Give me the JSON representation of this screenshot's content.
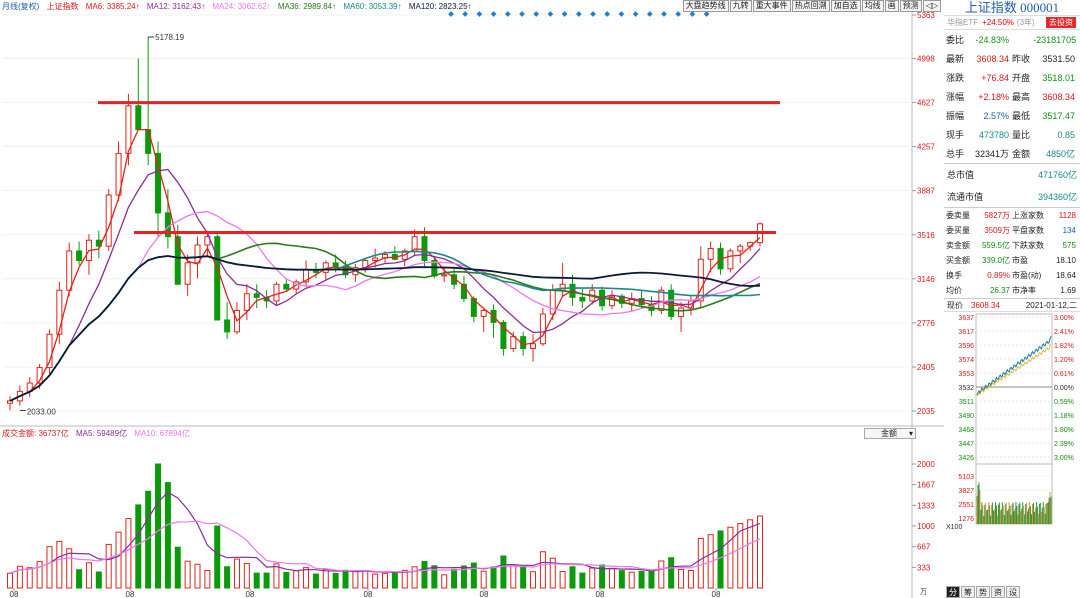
{
  "legend": {
    "period": "月线(复权)",
    "index": "上证指数",
    "ma6": "MA6: 3385.24↑",
    "ma12": "MA12: 3162.43↑",
    "ma24": "MA24: 3062.62↑",
    "ma36": "MA36: 2989.84↑",
    "ma60": "MA60: 3053.39↑",
    "ma120": "MA120: 2823.25↑"
  },
  "toolbar": [
    "大盘趋势线",
    "九转",
    "重大事件",
    "热点回溯",
    "加自选",
    "均线",
    "画",
    "预测",
    "◁▷"
  ],
  "price_axis": [
    "5363",
    "4998",
    "4627",
    "4257",
    "3887",
    "3516",
    "3146",
    "2776",
    "2405",
    "2035"
  ],
  "high_label": "5178.19",
  "low_label": "2033.00",
  "volume_legend": {
    "title": "成交金额: 36737亿",
    "ma5": "MA5: 59489亿",
    "ma10": "MA10: 67894亿"
  },
  "volume_select": "金额",
  "volume_axis": [
    "2000",
    "1667",
    "1333",
    "1000",
    "667",
    "333"
  ],
  "volume_unit": "万",
  "x_labels": [
    "08",
    "08",
    "08",
    "08",
    "08",
    "08",
    "08"
  ],
  "colors": {
    "up": "#e0241a",
    "down": "#0a9a0a",
    "resistance": "#e62222",
    "ma6": "#e0241a",
    "ma12": "#8a2c9a",
    "ma24": "#ee77ee",
    "ma36": "#2a7a18",
    "ma60": "#1a8a8a",
    "ma120": "#0a1a3a"
  },
  "panel": {
    "title": "上证指数 000001",
    "etf": {
      "name": "华指ETF",
      "change": "+24.50%",
      "tag": "(3年)",
      "button": "去投资"
    },
    "quote": [
      {
        "l": "委比",
        "v": "-24.83%",
        "vc": "g",
        "l2": "",
        "v2": "-23181705",
        "v2c": "g"
      },
      {
        "l": "最新",
        "v": "3608.34",
        "vc": "r",
        "l2": "昨收",
        "v2": "3531.50",
        "v2c": "k"
      },
      {
        "l": "涨跌",
        "v": "+76.84",
        "vc": "r",
        "l2": "开盘",
        "v2": "3518.01",
        "v2c": "g"
      },
      {
        "l": "涨幅",
        "v": "+2.18%",
        "vc": "r",
        "l2": "最高",
        "v2": "3608.34",
        "v2c": "r"
      },
      {
        "l": "振幅",
        "v": "2.57%",
        "vc": "bl",
        "l2": "最低",
        "v2": "3517.47",
        "v2c": "g"
      },
      {
        "l": "现手",
        "v": "473780",
        "vc": "tl",
        "l2": "量比",
        "v2": "0.85",
        "v2c": "tl"
      },
      {
        "l": "总手",
        "v": "32341万",
        "vc": "k",
        "l2": "金额",
        "v2": "4850亿",
        "v2c": "tl"
      }
    ],
    "total_cap": {
      "l": "总市值",
      "v": "471760亿"
    },
    "float_cap": {
      "l": "流通市值",
      "v": "394360亿"
    },
    "stats": [
      {
        "l": "委卖量",
        "v": "5827万",
        "vc": "r",
        "l2": "上涨家数",
        "v2": "1128",
        "v2c": "r"
      },
      {
        "l": "委买量",
        "v": "3509万",
        "vc": "r",
        "l2": "平盘家数",
        "v2": "134",
        "v2c": "bl"
      },
      {
        "l": "卖金额",
        "v": "559.5亿",
        "vc": "g",
        "l2": "下跌家数",
        "v2": "575",
        "v2c": "g"
      },
      {
        "l": "买金额",
        "v": "339.0亿",
        "vc": "g",
        "l2": "市盈",
        "v2": "18.10",
        "v2c": "k"
      },
      {
        "l": "换手",
        "v": "0.89%",
        "vc": "r",
        "l2": "市盈(动)",
        "v2": "18.64",
        "v2c": "k"
      },
      {
        "l": "均价",
        "v": "26.37",
        "vc": "g",
        "l2": "市净率",
        "v2": "1.69",
        "v2c": "k"
      }
    ],
    "intraday": {
      "label": "现价",
      "price": "3608.34",
      "date": "2021-01-12,二"
    },
    "intra_left": [
      "3637",
      "3617",
      "3596",
      "3574",
      "3553",
      "3532",
      "3511",
      "3490",
      "3468",
      "3447",
      "3426"
    ],
    "intra_right": [
      "3.00%",
      "2.41%",
      "1.82%",
      "1.20%",
      "0.61%",
      "0.00%",
      "0.59%",
      "1.18%",
      "1.80%",
      "2.39%",
      "3.00%"
    ],
    "intra_vol": [
      "5103",
      "3827",
      "2551",
      "1276"
    ],
    "intra_unit": "X100",
    "bottom_tabs": [
      "分",
      "筹",
      "势",
      "资",
      "设"
    ]
  },
  "chart_data": {
    "type": "candlestick",
    "description_series": "monthly OHLC of index (approximate)",
    "ohlc": [
      [
        2100,
        2160,
        2040,
        2120
      ],
      [
        2120,
        2250,
        2080,
        2200
      ],
      [
        2200,
        2320,
        2150,
        2270
      ],
      [
        2270,
        2430,
        2220,
        2400
      ],
      [
        2400,
        2720,
        2350,
        2680
      ],
      [
        2680,
        3120,
        2600,
        3050
      ],
      [
        3050,
        3450,
        3000,
        3380
      ],
      [
        3380,
        3460,
        3260,
        3300
      ],
      [
        3300,
        3520,
        3180,
        3470
      ],
      [
        3470,
        3550,
        3320,
        3420
      ],
      [
        3420,
        3900,
        3380,
        3850
      ],
      [
        3850,
        4300,
        3800,
        4200
      ],
      [
        4200,
        4700,
        4100,
        4600
      ],
      [
        4600,
        4998,
        4400,
        4400
      ],
      [
        4400,
        5178,
        4100,
        4200
      ],
      [
        4200,
        4300,
        3500,
        3700
      ],
      [
        3700,
        3900,
        3400,
        3500
      ],
      [
        3500,
        3600,
        3200,
        3100
      ],
      [
        3100,
        3350,
        3000,
        3280
      ],
      [
        3280,
        3500,
        3150,
        3430
      ],
      [
        3430,
        3550,
        3330,
        3500
      ],
      [
        3500,
        3520,
        2850,
        2800
      ],
      [
        2800,
        2950,
        2640,
        2700
      ],
      [
        2700,
        2950,
        2680,
        2880
      ],
      [
        2880,
        3100,
        2800,
        3020
      ],
      [
        3020,
        3100,
        2900,
        2990
      ],
      [
        2990,
        3050,
        2900,
        2960
      ],
      [
        2960,
        3120,
        2920,
        3100
      ],
      [
        3100,
        3150,
        3040,
        3060
      ],
      [
        3060,
        3140,
        3020,
        3120
      ],
      [
        3120,
        3300,
        3080,
        3220
      ],
      [
        3220,
        3280,
        3150,
        3200
      ],
      [
        3200,
        3300,
        3140,
        3280
      ],
      [
        3280,
        3350,
        3200,
        3250
      ],
      [
        3250,
        3300,
        3150,
        3180
      ],
      [
        3180,
        3270,
        3120,
        3240
      ],
      [
        3240,
        3320,
        3200,
        3300
      ],
      [
        3300,
        3400,
        3240,
        3320
      ],
      [
        3320,
        3380,
        3280,
        3350
      ],
      [
        3350,
        3420,
        3300,
        3310
      ],
      [
        3310,
        3400,
        3250,
        3380
      ],
      [
        3380,
        3560,
        3340,
        3500
      ],
      [
        3500,
        3580,
        3250,
        3300
      ],
      [
        3300,
        3320,
        3150,
        3170
      ],
      [
        3170,
        3250,
        3120,
        3180
      ],
      [
        3180,
        3230,
        3060,
        3100
      ],
      [
        3100,
        3170,
        2950,
        2980
      ],
      [
        2980,
        3000,
        2780,
        2830
      ],
      [
        2830,
        2900,
        2700,
        2880
      ],
      [
        2880,
        2930,
        2650,
        2780
      ],
      [
        2780,
        2800,
        2500,
        2560
      ],
      [
        2560,
        2700,
        2530,
        2660
      ],
      [
        2660,
        2700,
        2500,
        2560
      ],
      [
        2560,
        2680,
        2450,
        2600
      ],
      [
        2600,
        2900,
        2580,
        2850
      ],
      [
        2850,
        3100,
        2800,
        3050
      ],
      [
        3050,
        3280,
        3000,
        3100
      ],
      [
        3100,
        3180,
        2920,
        2990
      ],
      [
        2990,
        3060,
        2900,
        2960
      ],
      [
        2960,
        3100,
        2930,
        3050
      ],
      [
        3050,
        3080,
        2880,
        2920
      ],
      [
        2920,
        3050,
        2890,
        3000
      ],
      [
        3000,
        3020,
        2900,
        2940
      ],
      [
        2940,
        3030,
        2870,
        2980
      ],
      [
        2980,
        3050,
        2900,
        2930
      ],
      [
        2930,
        3000,
        2830,
        2880
      ],
      [
        2880,
        3080,
        2850,
        3050
      ],
      [
        3050,
        3100,
        2800,
        2830
      ],
      [
        2830,
        2950,
        2700,
        2900
      ],
      [
        2900,
        3000,
        2840,
        2960
      ],
      [
        2960,
        3420,
        2900,
        3310
      ],
      [
        3310,
        3460,
        3200,
        3400
      ],
      [
        3400,
        3450,
        3180,
        3230
      ],
      [
        3230,
        3400,
        3200,
        3380
      ],
      [
        3380,
        3440,
        3280,
        3420
      ],
      [
        3420,
        3460,
        3380,
        3450
      ],
      [
        3450,
        3620,
        3420,
        3608
      ]
    ],
    "resistance": [
      4627,
      3535
    ],
    "ylim": [
      2035,
      5363
    ],
    "volume_ylim": [
      0,
      2000
    ]
  }
}
